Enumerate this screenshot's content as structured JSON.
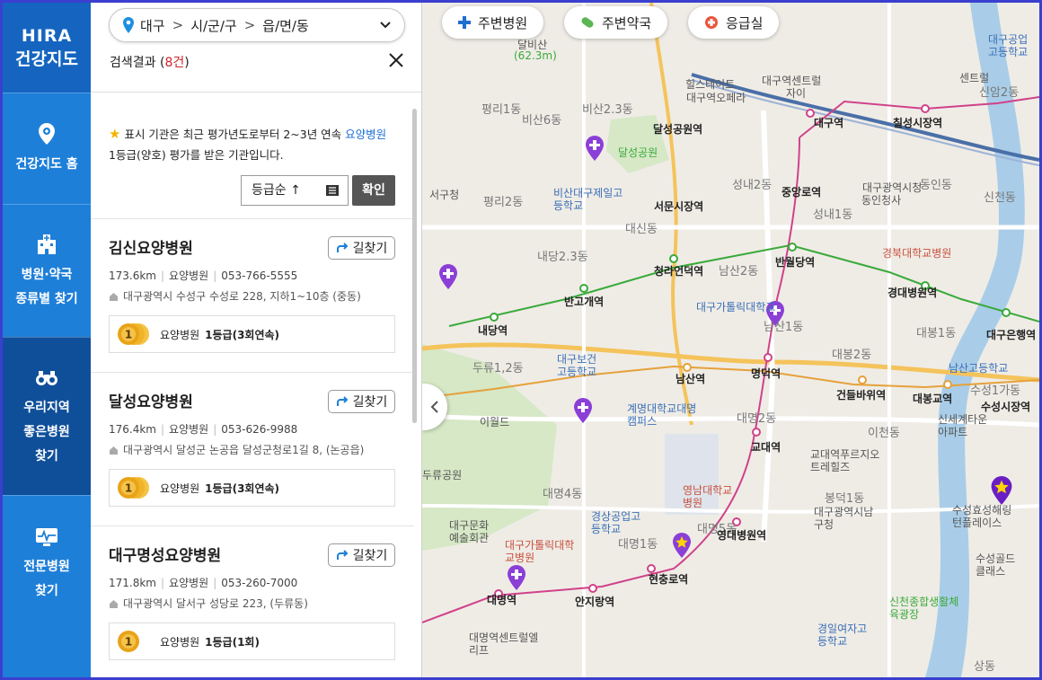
{
  "logo": {
    "line1": "HIRA",
    "line2": "건강지도"
  },
  "nav": {
    "items": [
      {
        "label1": "건강지도 홈",
        "label2": ""
      },
      {
        "label1": "병원·약국",
        "label2": "종류별 찾기"
      },
      {
        "label1": "우리지역",
        "label2": "좋은병원",
        "label3": "찾기"
      },
      {
        "label1": "전문병원",
        "label2": "찾기"
      }
    ]
  },
  "search": {
    "region1": "대구",
    "region2": "시/군/구",
    "region3": "읍/면/동",
    "result_prefix": "검색결과 (",
    "result_count": "8건",
    "result_suffix": ")"
  },
  "notice": {
    "text1": "표시 기관은 최근 평가년도로부터 2~3년 연속 ",
    "highlight": "요양병원",
    "text2": "1등급(양호) 평가를 받은 기관입니다."
  },
  "sort": {
    "label": "등급순 ↑",
    "confirm": "확인"
  },
  "hospitals": [
    {
      "name": "김신요양병원",
      "directions": "길찾기",
      "distance": "173.6km",
      "type": "요양병원",
      "phone": "053-766-5555",
      "address": "대구광역시 수성구 수성로 228, 지하1~10층 (중동)",
      "grade_type": "요양병원",
      "grade": "1등급(3회연속)",
      "medal": "1"
    },
    {
      "name": "달성요양병원",
      "directions": "길찾기",
      "distance": "176.4km",
      "type": "요양병원",
      "phone": "053-626-9988",
      "address": "대구광역시 달성군 논공읍 달성군청로1길 8, (논공읍)",
      "grade_type": "요양병원",
      "grade": "1등급(3회연속)",
      "medal": "1"
    },
    {
      "name": "대구명성요양병원",
      "directions": "길찾기",
      "distance": "171.8km",
      "type": "요양병원",
      "phone": "053-260-7000",
      "address": "대구광역시 달서구 성당로 223, (두류동)",
      "grade_type": "요양병원",
      "grade": "1등급(1회)",
      "medal": "1"
    }
  ],
  "map": {
    "chips": [
      "주변병원",
      "주변약국",
      "응급실"
    ],
    "labels": [
      {
        "t": "달비산",
        "c": ""
      },
      {
        "t": "(62.3m)",
        "c": ""
      },
      {
        "t": "힐스테이트",
        "c": ""
      },
      {
        "t": "대구역오페라",
        "c": ""
      },
      {
        "t": "대구역센트럴",
        "c": ""
      },
      {
        "t": "자이",
        "c": ""
      },
      {
        "t": "평리1동",
        "c": "big"
      },
      {
        "t": "비산6동",
        "c": "big"
      },
      {
        "t": "비산2.3동",
        "c": "big"
      },
      {
        "t": "달성공원역",
        "c": "station"
      },
      {
        "t": "달성공원",
        "c": ""
      },
      {
        "t": "대구역",
        "c": "station"
      },
      {
        "t": "칠성시장역",
        "c": "station"
      },
      {
        "t": "대구공업고등학교",
        "c": "blue"
      },
      {
        "t": "센트럴",
        "c": ""
      },
      {
        "t": "신암2동",
        "c": "big"
      },
      {
        "t": "신천동",
        "c": "big"
      },
      {
        "t": "서구청",
        "c": ""
      },
      {
        "t": "평리2동",
        "c": "big"
      },
      {
        "t": "비산대구제일고등학교",
        "c": "blue"
      },
      {
        "t": "서문시장역",
        "c": "station"
      },
      {
        "t": "성내2동",
        "c": "big"
      },
      {
        "t": "중앙로역",
        "c": "station"
      },
      {
        "t": "성내1동",
        "c": "big"
      },
      {
        "t": "대구광역시청",
        "c": ""
      },
      {
        "t": "동인청사",
        "c": ""
      },
      {
        "t": "동인동",
        "c": "big"
      },
      {
        "t": "대신동",
        "c": "big"
      },
      {
        "t": "내당2.3동",
        "c": "big"
      },
      {
        "t": "청라언덕역",
        "c": "station"
      },
      {
        "t": "남산2동",
        "c": "big"
      },
      {
        "t": "반월당역",
        "c": "station"
      },
      {
        "t": "경북대학교병원",
        "c": "red"
      },
      {
        "t": "경대병원역",
        "c": "station"
      },
      {
        "t": "반고개역",
        "c": "station"
      },
      {
        "t": "대구가톨릭대학교",
        "c": "blue"
      },
      {
        "t": "남산1동",
        "c": "big"
      },
      {
        "t": "내당역",
        "c": "station"
      },
      {
        "t": "두류1,2동",
        "c": "big"
      },
      {
        "t": "대구보건고등학교",
        "c": "blue"
      },
      {
        "t": "남산역",
        "c": "station"
      },
      {
        "t": "명덕역",
        "c": "station"
      },
      {
        "t": "대봉2동",
        "c": "big"
      },
      {
        "t": "건들바위역",
        "c": "station"
      },
      {
        "t": "대봉교역",
        "c": "station"
      },
      {
        "t": "남산고등학교",
        "c": "blue"
      },
      {
        "t": "대봉1동",
        "c": "big"
      },
      {
        "t": "이월드",
        "c": ""
      },
      {
        "t": "계명대학교대명캠퍼스",
        "c": "blue"
      },
      {
        "t": "대명2동",
        "c": "big"
      },
      {
        "t": "교대역",
        "c": "station"
      },
      {
        "t": "이천동",
        "c": "big"
      },
      {
        "t": "수성1가동",
        "c": "big"
      },
      {
        "t": "수성시장역",
        "c": "station"
      },
      {
        "t": "대구은행역",
        "c": "station"
      },
      {
        "t": "신세계타운아파트",
        "c": ""
      },
      {
        "t": "교대역푸르지오트레힐즈",
        "c": ""
      },
      {
        "t": "대명4동",
        "c": "big"
      },
      {
        "t": "영남대학교병원",
        "c": "red"
      },
      {
        "t": "봉덕1동",
        "c": "big"
      },
      {
        "t": "수성효성해링턴플레이스",
        "c": ""
      },
      {
        "t": "경상공업고등학교",
        "c": "blue"
      },
      {
        "t": "대명1동",
        "c": "big"
      },
      {
        "t": "대명5동",
        "c": "big"
      },
      {
        "t": "영대병원역",
        "c": "station"
      },
      {
        "t": "대구가톨릭대학교병원",
        "c": "red"
      },
      {
        "t": "대구문화예술회관",
        "c": ""
      },
      {
        "t": "대명역",
        "c": "station"
      },
      {
        "t": "안지랑역",
        "c": "station"
      },
      {
        "t": "현충로역",
        "c": "station"
      },
      {
        "t": "신천종합생활체육광장",
        "c": ""
      },
      {
        "t": "수성골드클래스",
        "c": ""
      },
      {
        "t": "대명역센트럴엘리프",
        "c": ""
      },
      {
        "t": "경일여자고등학교",
        "c": "blue"
      },
      {
        "t": "상동",
        "c": "big"
      },
      {
        "t": "두류공원",
        "c": ""
      },
      {
        "t": "대구광역시남구청",
        "c": ""
      }
    ]
  },
  "colors": {
    "nav_bg": "#1e7fd8",
    "nav_active": "#0f4f9a",
    "accent_blue": "#1e6fd0",
    "count_red": "#d2232a",
    "medal_gold": "#e8a317"
  }
}
